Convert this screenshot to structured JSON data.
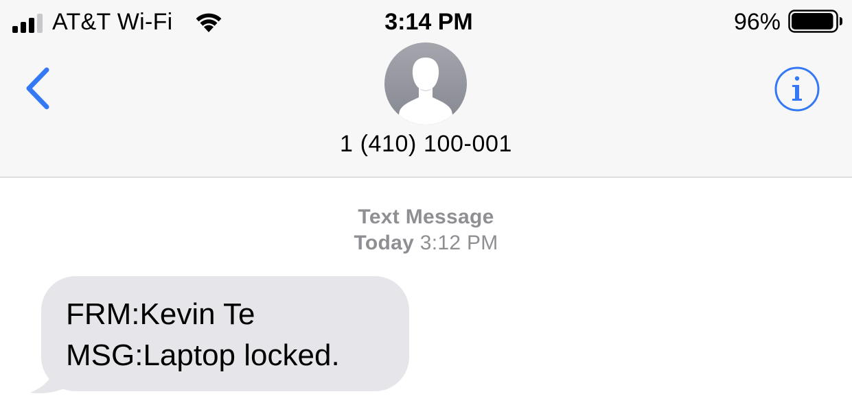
{
  "status_bar": {
    "carrier": "AT&T Wi-Fi",
    "time": "3:14 PM",
    "battery_percent": "96%",
    "signal_bars_filled": 3,
    "signal_bars_total": 4,
    "battery_level": 0.96
  },
  "nav": {
    "back_icon": "chevron-left-icon",
    "avatar_icon": "person-silhouette-icon",
    "contact_name": "1 (410) 100-001",
    "info_icon": "info-circle-icon",
    "accent_color": "#3478f6"
  },
  "conversation": {
    "service_label": "Text Message",
    "timestamp_day": "Today",
    "timestamp_time": "3:12 PM",
    "messages": [
      {
        "direction": "incoming",
        "lines": [
          "FRM:Kevin Te",
          "MSG:Laptop locked."
        ],
        "bubble_color": "#e5e5ea"
      }
    ]
  }
}
